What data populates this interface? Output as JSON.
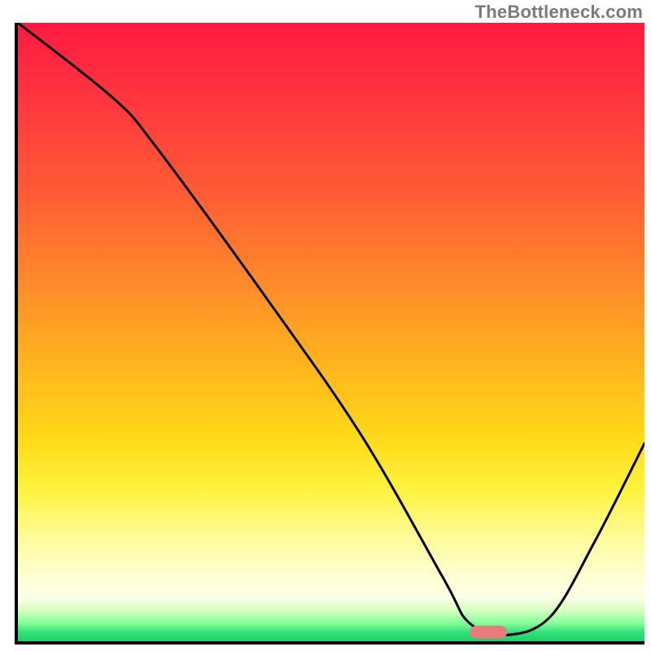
{
  "watermark": "TheBottleneck.com",
  "chart_data": {
    "type": "line",
    "title": "",
    "xlabel": "",
    "ylabel": "",
    "xlim": [
      0,
      100
    ],
    "ylim": [
      0,
      100
    ],
    "grid": false,
    "legend": false,
    "series": [
      {
        "name": "bottleneck-curve",
        "x": [
          0,
          15,
          22,
          40,
          55,
          68,
          72,
          78,
          85,
          92,
          100
        ],
        "values": [
          100,
          88,
          80,
          55,
          33,
          10,
          3,
          1,
          4,
          16,
          32
        ]
      }
    ],
    "marker": {
      "x": 75,
      "y": 1.5,
      "color": "#e77b7d"
    },
    "background_gradient": {
      "top": "#ff1a3f",
      "mid": "#ffd918",
      "low": "#ffffd6",
      "bottom": "#1ecf6a"
    }
  }
}
